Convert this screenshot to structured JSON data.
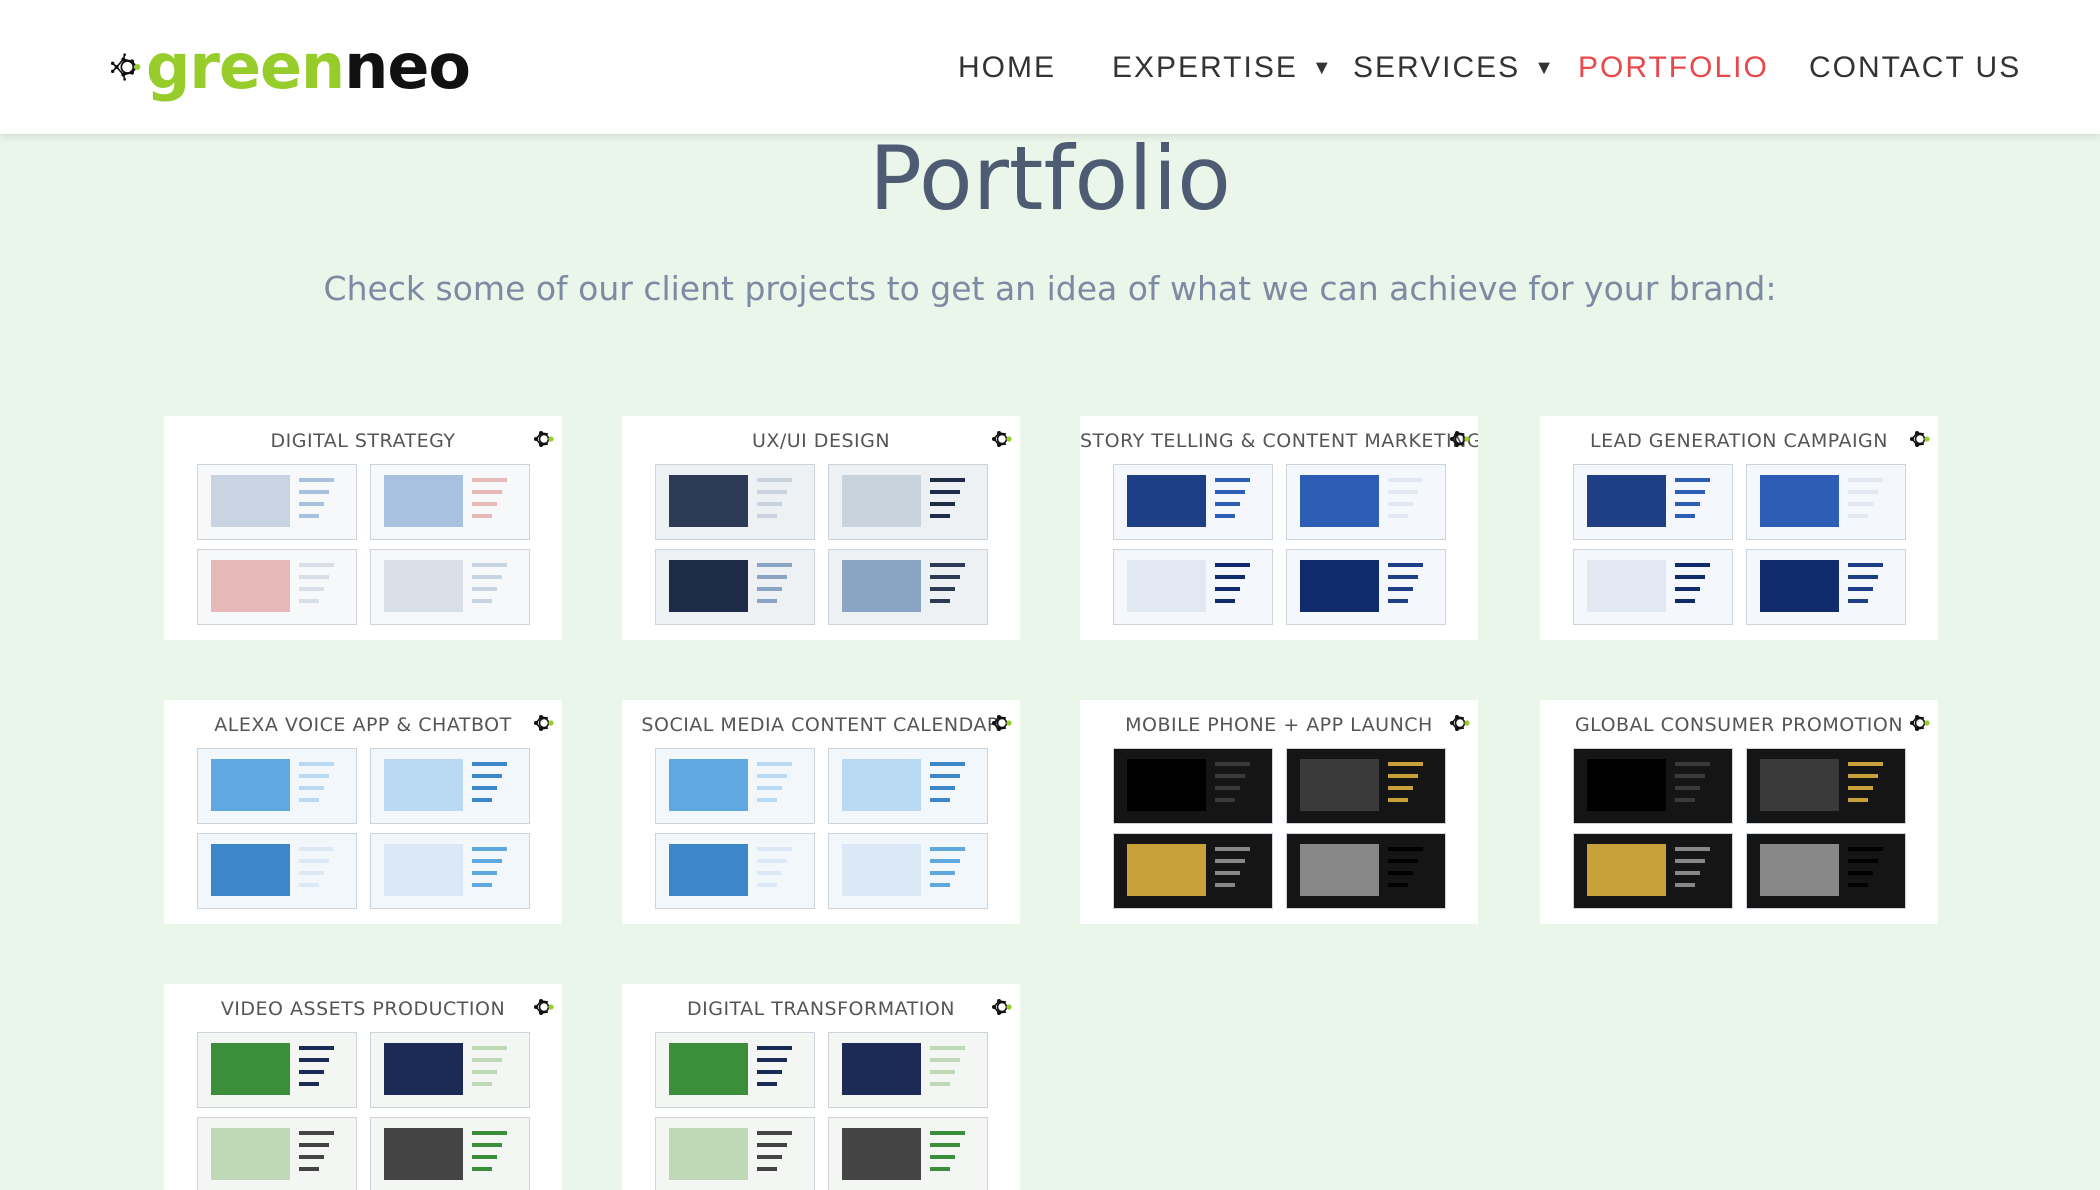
{
  "header": {
    "logo": {
      "part1": "green",
      "part2": "eo",
      "letter_n": "n",
      "icon": "network-molecule-logo-icon"
    },
    "nav": [
      {
        "label": "HOME",
        "active": false,
        "dropdown": false
      },
      {
        "label": "EXPERTISE",
        "active": false,
        "dropdown": true
      },
      {
        "label": "SERVICES",
        "active": false,
        "dropdown": true
      },
      {
        "label": "PORTFOLIO",
        "active": true,
        "dropdown": false
      },
      {
        "label": "CONTACT US",
        "active": false,
        "dropdown": false
      }
    ],
    "caret_glyph": "▼"
  },
  "main": {
    "title": "Portfolio",
    "subtitle": "Check some of our client projects to get an idea of what we can achieve for your brand:"
  },
  "portfolio": [
    {
      "title": "DIGITAL STRATEGY",
      "theme": "light"
    },
    {
      "title": "UX/UI DESIGN",
      "theme": "mixed"
    },
    {
      "title": "STORY TELLING & CONTENT MARKETING",
      "theme": "blue"
    },
    {
      "title": "LEAD GENERATION CAMPAIGN",
      "theme": "blue"
    },
    {
      "title": "ALEXA VOICE APP & CHATBOT",
      "theme": "light-blue"
    },
    {
      "title": "SOCIAL MEDIA CONTENT CALENDAR",
      "theme": "light-blue"
    },
    {
      "title": "MOBILE PHONE + APP LAUNCH",
      "theme": "dark"
    },
    {
      "title": "GLOBAL CONSUMER PROMOTION",
      "theme": "dark"
    },
    {
      "title": "VIDEO ASSETS PRODUCTION",
      "theme": "green"
    },
    {
      "title": "DIGITAL TRANSFORMATION",
      "theme": "green"
    }
  ],
  "colors": {
    "brand_green": "#96cd2a",
    "nav_active": "#e8484a",
    "page_bg": "#eaf6ea",
    "title": "#4d5b73"
  }
}
